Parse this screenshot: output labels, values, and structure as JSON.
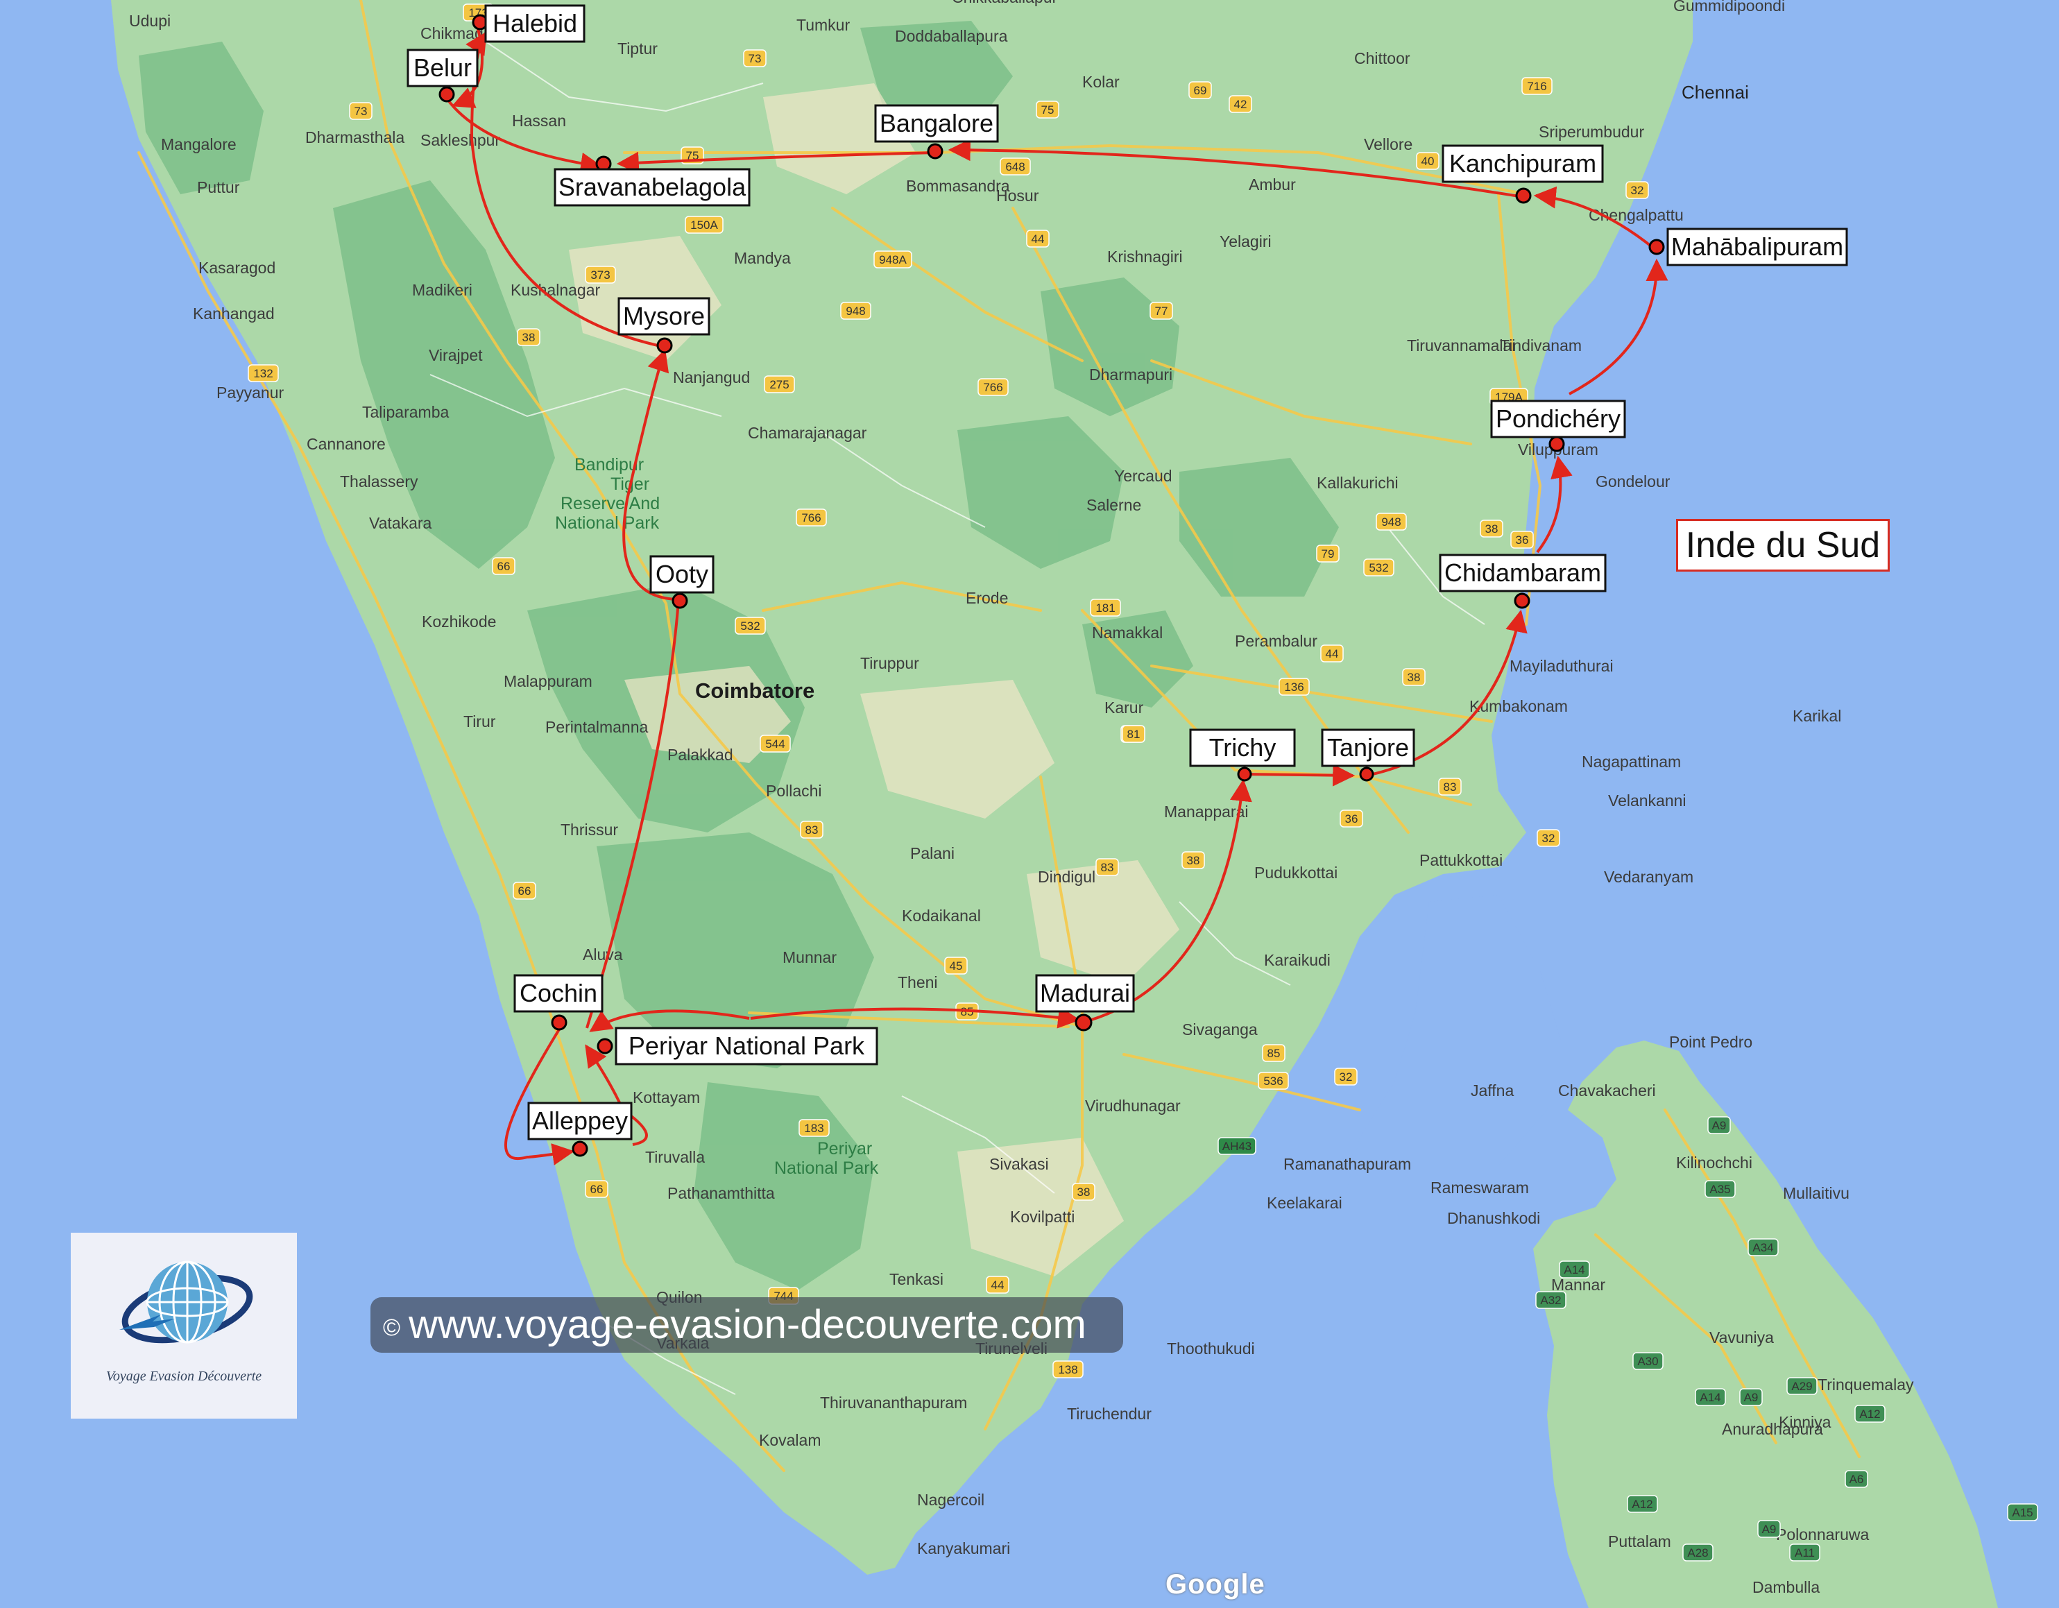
{
  "region_label": "Inde du Sud",
  "watermark": "www.voyage-evasion-decouverte.com",
  "watermark_symbol": "©",
  "logo_caption": "Voyage Evasion Découverte",
  "attribution": "Google",
  "colors": {
    "sea": "#8fb7f2",
    "land": "#a9d7a6",
    "route": "#e2261b",
    "label_border": "#111111",
    "region_border": "#d62c22",
    "road": "#f5c94a"
  },
  "stops": [
    {
      "name": "Halebid"
    },
    {
      "name": "Belur"
    },
    {
      "name": "Bangalore"
    },
    {
      "name": "Sravanabelagola"
    },
    {
      "name": "Kanchipuram"
    },
    {
      "name": "Mahābalipuram"
    },
    {
      "name": "Mysore"
    },
    {
      "name": "Pondichéry"
    },
    {
      "name": "Ooty"
    },
    {
      "name": "Chidambaram"
    },
    {
      "name": "Trichy"
    },
    {
      "name": "Tanjore"
    },
    {
      "name": "Cochin"
    },
    {
      "name": "Madurai"
    },
    {
      "name": "Periyar National Park"
    },
    {
      "name": "Alleppey"
    }
  ],
  "towns": [
    "Udupi",
    "Chikmagalur",
    "Tiptur",
    "Tumkur",
    "Chikkaballapur",
    "Doddaballapura",
    "Gummidipoondi",
    "Kolar",
    "Chittoor",
    "Chennai",
    "Sriperumbudur",
    "Hassan",
    "Dharmasthala",
    "Sakleshpur",
    "Mangalore",
    "Vellore",
    "Bommasandra",
    "Hosur",
    "Ambur",
    "Chengalpattu",
    "Puttur",
    "Kasaragod",
    "Madikeri",
    "Kushalnagar",
    "Mandya",
    "Krishnagiri",
    "Yelagiri",
    "Kanhangad",
    "Virajpet",
    "Tiruvannamalai",
    "Tindivanam",
    "Payyanur",
    "Taliparamba",
    "Nanjangud",
    "Dharmapuri",
    "Cannanore",
    "Chamarajanagar",
    "Thalassery",
    "Viluppuram",
    "Yercaud",
    "Kallakurichi",
    "Gondelour",
    "Vatakara",
    "Salerne",
    "Kozhikode",
    "Erode",
    "Namakkal",
    "Perambalur",
    "Malappuram",
    "Tiruppur",
    "Mayiladuthurai",
    "Tirur",
    "Perintalmanna",
    "Karur",
    "Kumbakonam",
    "Karikal",
    "Palakkad",
    "Nagapattinam",
    "Pollachi",
    "Thrissur",
    "Manapparai",
    "Velankanni",
    "Palani",
    "Pattukkottai",
    "Dindigul",
    "Pudukkottai",
    "Vedaranyam",
    "Kodaikanal",
    "Aluva",
    "Munnar",
    "Karaikudi",
    "Theni",
    "Sivaganga",
    "Point Pedro",
    "Kottayam",
    "Jaffna",
    "Chavakacheri",
    "Virudhunagar",
    "Tiruvalla",
    "Kilinochchi",
    "Sivakasi",
    "Ramanathapuram",
    "Mullaitivu",
    "Pathanamthitta",
    "Rameswaram",
    "Keelakarai",
    "Dhanushkodi",
    "Kovilpatti",
    "Mannar",
    "Tenkasi",
    "Vavuniya",
    "Quilon",
    "Varkala",
    "Tirunelveli",
    "Thoothukudi",
    "Trinquemalay",
    "Kinniya",
    "Thiruvananthapuram",
    "Tiruchendur",
    "Kovalam",
    "Anuradhapura",
    "Nagercoil",
    "Puttalam",
    "Kanyakumari",
    "Polonnaruwa",
    "Dambulla"
  ],
  "towns_bold": [
    "Coimbatore"
  ],
  "parks": [
    "Bandipur",
    "Tiger",
    "Reserve And",
    "National Park",
    "Periyar",
    "National Park"
  ],
  "shields": [
    "173",
    "73",
    "73",
    "75",
    "75",
    "69",
    "42",
    "716",
    "40",
    "32",
    "648",
    "150A",
    "948A",
    "373",
    "948",
    "77",
    "44",
    "38",
    "275",
    "766",
    "179A",
    "132",
    "66",
    "766",
    "948",
    "79",
    "532",
    "38",
    "36",
    "532",
    "181",
    "44",
    "136",
    "38",
    "81",
    "81",
    "544",
    "83",
    "32",
    "36",
    "38",
    "83",
    "66",
    "45",
    "85",
    "83",
    "32",
    "536",
    "85",
    "183",
    "AH43",
    "66",
    "38",
    "744",
    "44",
    "138",
    "A9",
    "A35",
    "A34",
    "A14",
    "A32",
    "A30",
    "A14",
    "A9",
    "A29",
    "A12",
    "A6",
    "A12",
    "A9",
    "A28",
    "A11",
    "A15"
  ]
}
